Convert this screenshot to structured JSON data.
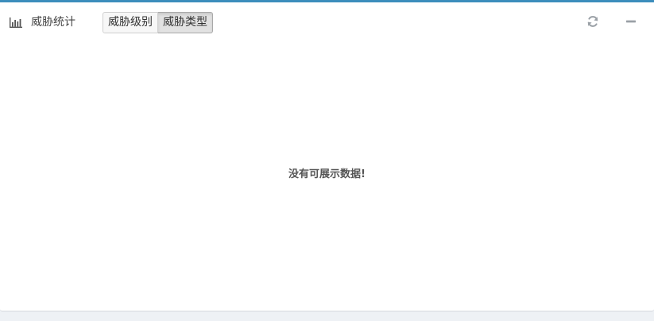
{
  "panel": {
    "title": "威胁统计",
    "title_icon": "bar-chart-icon",
    "accent_color": "#3c8dbc"
  },
  "tabs": [
    {
      "label": "威胁级别",
      "active": false
    },
    {
      "label": "威胁类型",
      "active": true
    }
  ],
  "tools": {
    "refresh_icon": "refresh-icon",
    "collapse_icon": "minus-icon"
  },
  "body": {
    "empty_message": "没有可展示数据!"
  }
}
